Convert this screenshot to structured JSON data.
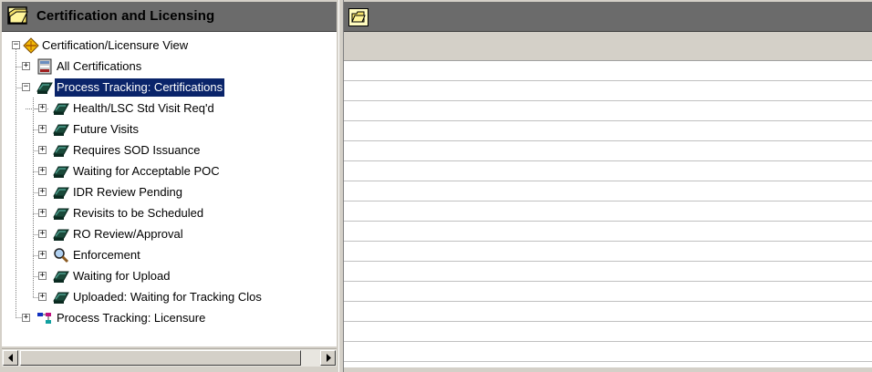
{
  "left_pane": {
    "title": "Certification and Licensing",
    "tree": {
      "root": {
        "label": "Certification/Licensure View",
        "icon": "diamond-leaf-icon",
        "expanded": true
      },
      "items": [
        {
          "label": "All Certifications",
          "icon": "form-document-icon",
          "expander": "+",
          "level": 1
        },
        {
          "label": "Process Tracking: Certifications",
          "icon": "tracking-ribbon-icon",
          "expander": "−",
          "level": 1,
          "selected": true
        },
        {
          "label": "Health/LSC Std Visit Req'd",
          "icon": "tracking-ribbon-icon",
          "expander": "+",
          "level": 2
        },
        {
          "label": "Future Visits",
          "icon": "tracking-ribbon-icon",
          "expander": "+",
          "level": 2
        },
        {
          "label": "Requires SOD Issuance",
          "icon": "tracking-ribbon-icon",
          "expander": "+",
          "level": 2
        },
        {
          "label": "Waiting for Acceptable POC",
          "icon": "tracking-ribbon-icon",
          "expander": "+",
          "level": 2
        },
        {
          "label": "IDR Review Pending",
          "icon": "tracking-ribbon-icon",
          "expander": "+",
          "level": 2
        },
        {
          "label": "Revisits to be Scheduled",
          "icon": "tracking-ribbon-icon",
          "expander": "+",
          "level": 2
        },
        {
          "label": "RO Review/Approval",
          "icon": "tracking-ribbon-icon",
          "expander": "+",
          "level": 2
        },
        {
          "label": "Enforcement",
          "icon": "magnifier-icon",
          "expander": "+",
          "level": 2
        },
        {
          "label": "Waiting for Upload",
          "icon": "tracking-ribbon-icon",
          "expander": "+",
          "level": 2
        },
        {
          "label": "Uploaded: Waiting for Tracking Clos",
          "icon": "tracking-ribbon-icon",
          "expander": "+",
          "level": 2
        },
        {
          "label": "Process Tracking: Licensure",
          "icon": "org-chart-icon",
          "expander": "+",
          "level": 1
        }
      ]
    }
  },
  "right_pane": {
    "toolbar": {
      "folder_button_icon": "open-folder-icon"
    },
    "row_count": 15
  },
  "colors": {
    "header_bg": "#6b6b6b",
    "selection_bg": "#0a246a",
    "ribbon_dark": "#1a4a3a",
    "ribbon_light": "#4a9a8a"
  }
}
